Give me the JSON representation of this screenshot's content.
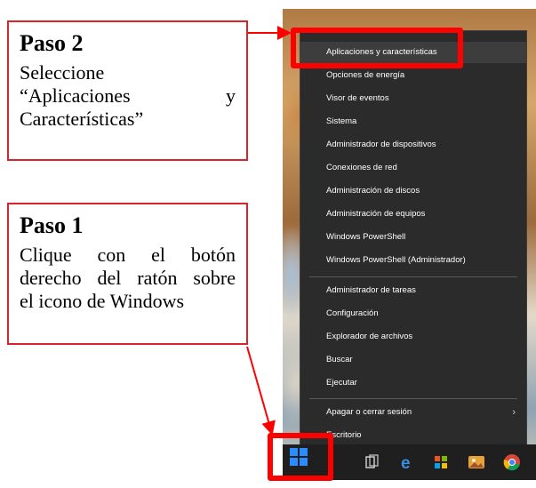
{
  "step2": {
    "title": "Paso 2",
    "line1": "Seleccione",
    "line2_left": "“Aplicaciones",
    "line2_right": "y",
    "line3": "Características”"
  },
  "step1": {
    "title": "Paso 1",
    "line1": "Clique con el botón",
    "line2": "derecho del ratón sobre",
    "line3": "el icono de Windows"
  },
  "menu": {
    "items": [
      "Aplicaciones y características",
      "Opciones de energía",
      "Visor de eventos",
      "Sistema",
      "Administrador de dispositivos",
      "Conexiones de red",
      "Administración de discos",
      "Administración de equipos",
      "Windows PowerShell",
      "Windows PowerShell (Administrador)",
      "Administrador de tareas",
      "Configuración",
      "Explorador de archivos",
      "Buscar",
      "Ejecutar",
      "Apagar o cerrar sesión",
      "Escritorio"
    ],
    "submenu_arrow": "›"
  },
  "taskbar": {
    "icons": [
      "windows-start-icon",
      "task-view-icon",
      "edge-icon",
      "store-icon",
      "photos-icon",
      "chrome-icon"
    ]
  },
  "colors": {
    "highlight_red": "#ff0000",
    "callout_border": "#d9242a",
    "menu_bg": "#2b2b2b",
    "windows_blue": "#2a8cff"
  }
}
